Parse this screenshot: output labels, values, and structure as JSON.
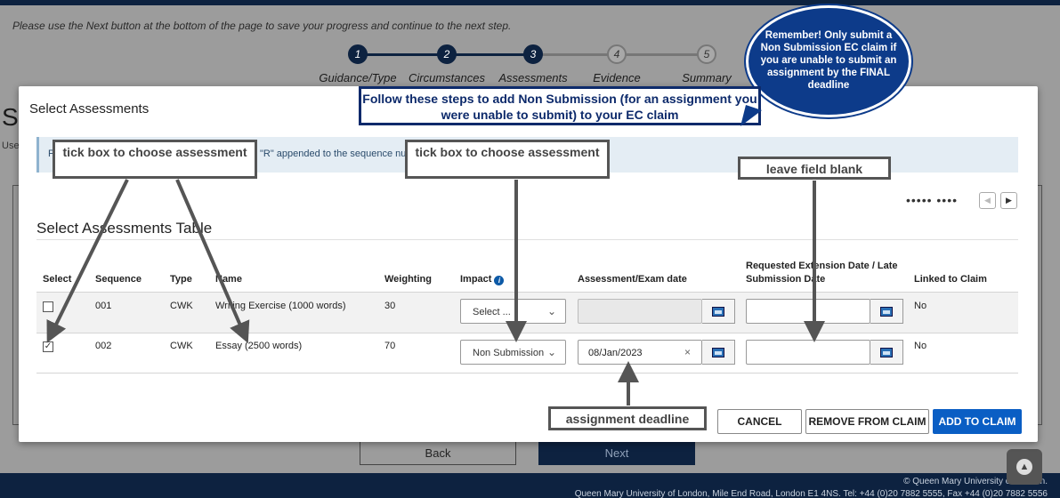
{
  "page": {
    "instruction": "Please use the Next button at the bottom of the page to save your progress and continue to the next step.",
    "steps": [
      {
        "num": "1",
        "label": "Guidance/Type"
      },
      {
        "num": "2",
        "label": "Circumstances"
      },
      {
        "num": "3",
        "label": "Assessments"
      },
      {
        "num": "4",
        "label": "Evidence"
      },
      {
        "num": "5",
        "label": "Summary"
      }
    ],
    "current_step": 3,
    "heading_fragment": "S",
    "use_fragment": "Use",
    "back_label": "Back",
    "next_label": "Next",
    "footer_copyright": "© Queen Mary University of London.",
    "footer_address": "Queen Mary University of London, Mile End Road, London E1 4NS. Tel: +44 (0)20 7882 5555, Fax +44 (0)20 7882 5556"
  },
  "modal": {
    "title": "Select Assessments",
    "info_prefix": "F",
    "info_text": "\"R\" appended to the sequence num",
    "pager_dots": "••••• ••••",
    "table_title": "Select Assessments Table",
    "columns": {
      "select": "Select",
      "sequence": "Sequence",
      "type": "Type",
      "name": "Name",
      "weighting": "Weighting",
      "impact": "Impact",
      "exam_date": "Assessment/Exam date",
      "extension_line1": "Requested Extension Date / Late",
      "extension_line2": "Submission Date",
      "linked": "Linked to Claim"
    },
    "rows": [
      {
        "checked": "",
        "sequence": "001",
        "type": "CWK",
        "name": "Writing Exercise (1000 words)",
        "weighting": "30",
        "impact": "Select ...",
        "exam_date": "",
        "extension_date": "",
        "linked": "No"
      },
      {
        "checked": "✓",
        "sequence": "002",
        "type": "CWK",
        "name": "Essay (2500 words)",
        "weighting": "70",
        "impact": "Non Submission",
        "exam_date": "08/Jan/2023",
        "extension_date": "",
        "linked": "No"
      }
    ],
    "buttons": {
      "cancel": "CANCEL",
      "remove": "REMOVE FROM CLAIM",
      "add": "ADD TO CLAIM"
    }
  },
  "annotations": {
    "tick_box_1": "tick box to choose assessment",
    "tick_box_2": "tick box to choose assessment",
    "leave_blank": "leave field blank",
    "assignment_deadline": "assignment deadline",
    "follow_steps": "Follow these steps to add Non Submission (for an assignment you were unable to submit) to your EC claim",
    "bubble": "Remember! Only submit a Non Submission EC claim if you are unable to submit an assignment by the FINAL deadline"
  },
  "colors": {
    "navy": "#0d2240",
    "primary_button": "#0a5ec4",
    "annotation_gray": "#555555",
    "annotation_blue": "#0d2a6b"
  }
}
